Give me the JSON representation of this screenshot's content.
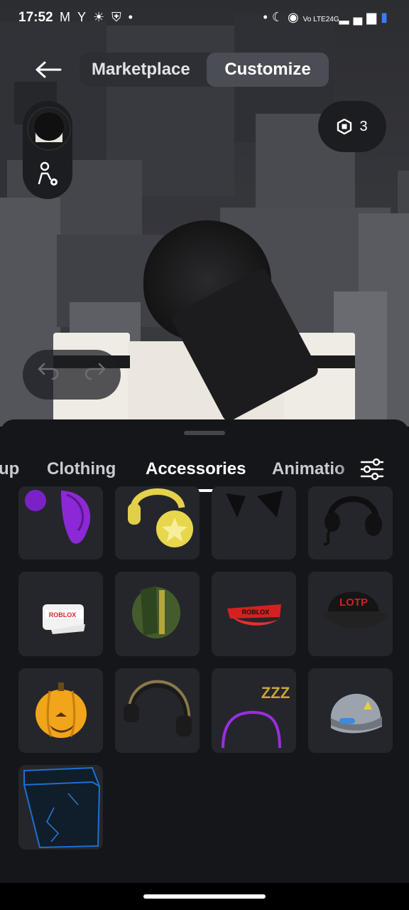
{
  "status_bar": {
    "time": "17:52",
    "left_icons": [
      "gmail-icon",
      "app-icon",
      "app-icon",
      "shield-icon",
      "dot-icon"
    ],
    "right_icons": [
      "dot-icon",
      "moon-icon",
      "hotspot-icon",
      "volte-icon",
      "signal-icon",
      "battery-icon"
    ],
    "network_label": "Vo LTE2",
    "network_type": "4G"
  },
  "header": {
    "back_icon": "arrow-left-icon",
    "tabs": [
      {
        "label": "Marketplace",
        "selected": false
      },
      {
        "label": "Customize",
        "selected": true
      }
    ]
  },
  "robux": {
    "icon": "robux-icon",
    "amount": "3"
  },
  "avatar": {
    "settings_icon": "avatar-settings-icon"
  },
  "history": {
    "undo_icon": "undo-icon",
    "redo_icon": "redo-icon"
  },
  "categories": {
    "tabs": [
      {
        "label": "up",
        "active": false
      },
      {
        "label": "Clothing",
        "active": false
      },
      {
        "label": "Accessories",
        "active": true
      },
      {
        "label": "Animatio",
        "active": false
      }
    ],
    "filter_icon": "sliders-icon"
  },
  "items": [
    {
      "name": "purple-wings-accessory"
    },
    {
      "name": "yellow-star-headphones"
    },
    {
      "name": "black-cat-ears"
    },
    {
      "name": "black-headset"
    },
    {
      "name": "roblox-white-visor",
      "text": "ROBLOX"
    },
    {
      "name": "green-hood"
    },
    {
      "name": "red-roblox-visor",
      "text": "ROBLOX"
    },
    {
      "name": "lotp-black-cap",
      "text": "LOTP"
    },
    {
      "name": "pumpkin-backpack"
    },
    {
      "name": "black-headphones"
    },
    {
      "name": "zzz-headband",
      "text": "ZZZ"
    },
    {
      "name": "space-helmet"
    },
    {
      "name": "blue-cube-accessory"
    }
  ],
  "colors": {
    "panel": "#151619",
    "tile": "#25262b",
    "selected_tab_bg": "#4b4d55",
    "accent_white": "#ffffff"
  }
}
